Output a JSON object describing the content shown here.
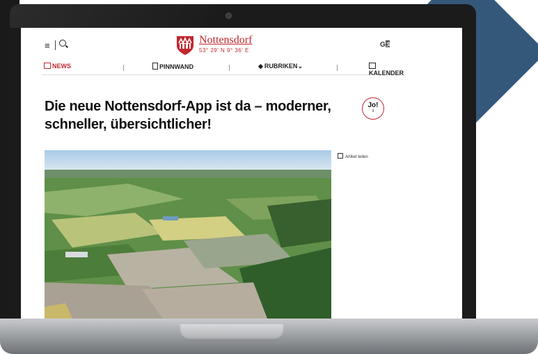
{
  "header": {
    "brand": "Nottensdorf",
    "coords": "53° 29' N 9° 36' E",
    "lang_icon": "translate-icon",
    "menu_icon": "≡"
  },
  "nav": {
    "items": [
      {
        "label": "NEWS",
        "icon": "newspaper-icon",
        "active": true
      },
      {
        "label": "PINNWAND",
        "icon": "clipboard-icon",
        "active": false
      },
      {
        "label": "RUBRIKEN",
        "icon": "layers-icon",
        "active": false
      },
      {
        "label": "KALENDER",
        "icon": "calendar-icon",
        "active": false
      }
    ]
  },
  "article": {
    "title": "Die neue Nottensdorf-App ist da – moder­ner, schneller, übersichtlicher!",
    "jo_label": "Jo!",
    "jo_count": "9",
    "share_label": "Artikel teilen"
  },
  "colors": {
    "accent": "#c0282e",
    "diamond": "#34587a"
  }
}
